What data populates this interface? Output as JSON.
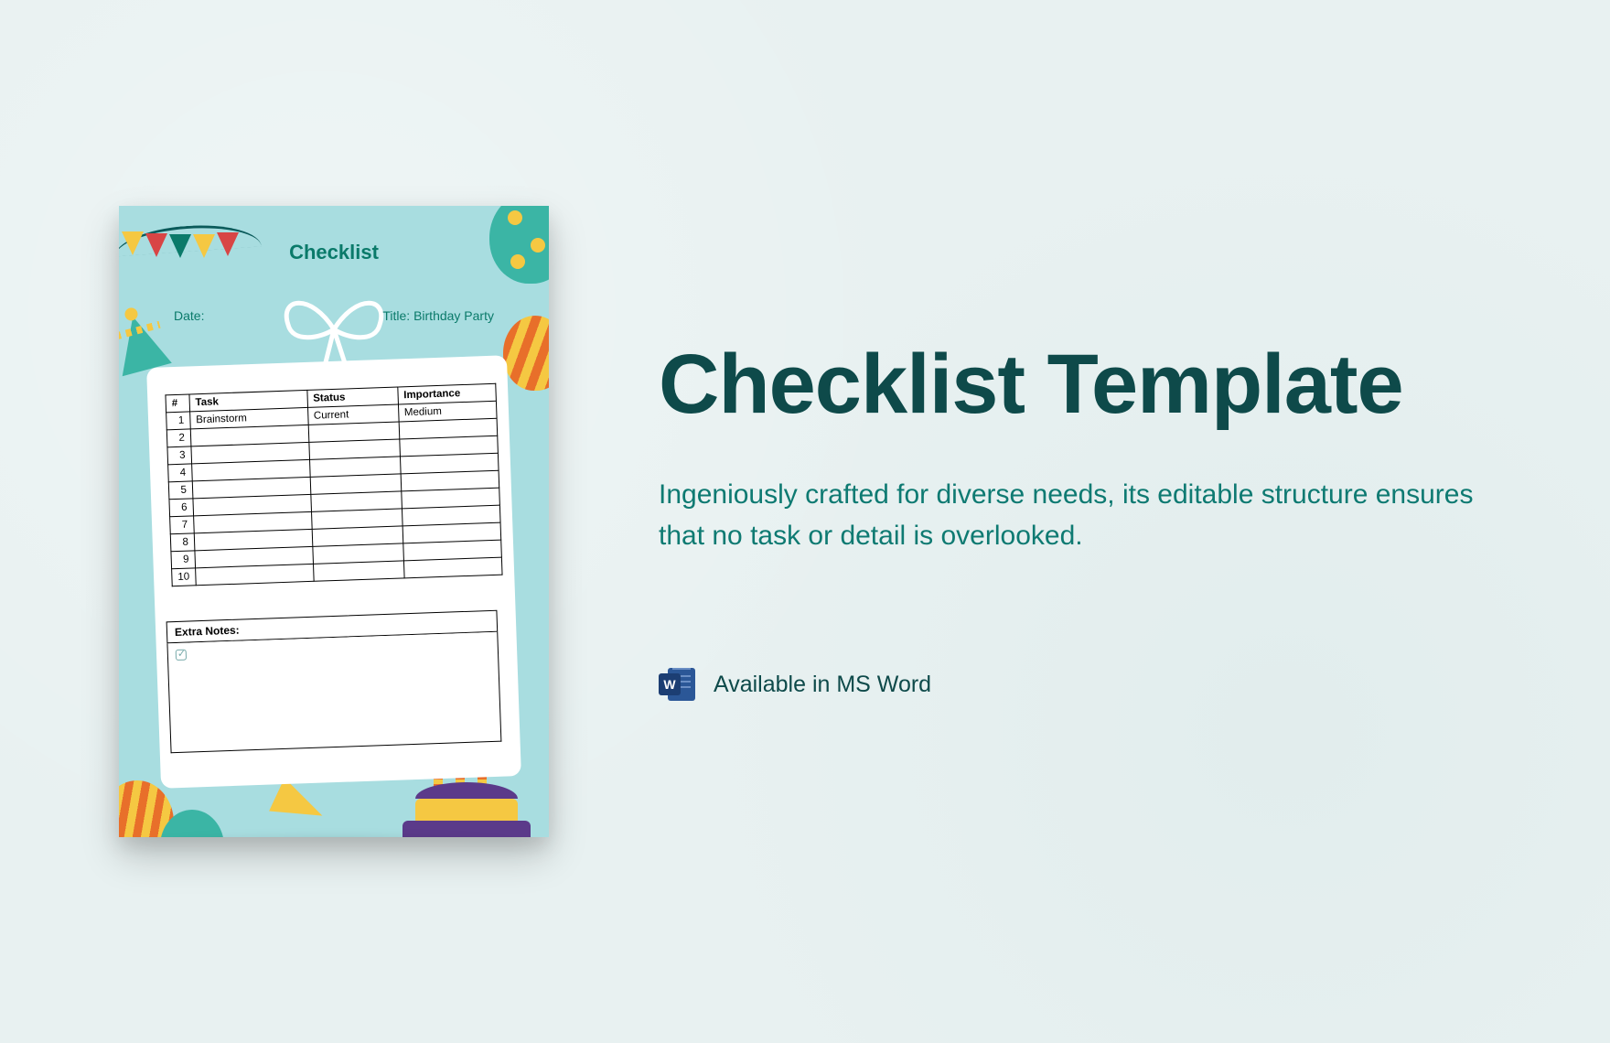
{
  "right": {
    "headline": "Checklist Template",
    "description": "Ingeniously crafted for diverse needs, its editable structure ensures that no task or detail is overlooked.",
    "word_letter": "W",
    "available_text": "Available in MS Word"
  },
  "preview": {
    "heading": "Checklist",
    "date_label": "Date:",
    "title_label": "Title:",
    "title_value": "Birthday Party",
    "table": {
      "headers": {
        "num": "#",
        "task": "Task",
        "status": "Status",
        "importance": "Importance"
      },
      "rows": [
        {
          "num": "1",
          "task": "Brainstorm",
          "status": "Current",
          "importance": "Medium"
        },
        {
          "num": "2",
          "task": "",
          "status": "",
          "importance": ""
        },
        {
          "num": "3",
          "task": "",
          "status": "",
          "importance": ""
        },
        {
          "num": "4",
          "task": "",
          "status": "",
          "importance": ""
        },
        {
          "num": "5",
          "task": "",
          "status": "",
          "importance": ""
        },
        {
          "num": "6",
          "task": "",
          "status": "",
          "importance": ""
        },
        {
          "num": "7",
          "task": "",
          "status": "",
          "importance": ""
        },
        {
          "num": "8",
          "task": "",
          "status": "",
          "importance": ""
        },
        {
          "num": "9",
          "task": "",
          "status": "",
          "importance": ""
        },
        {
          "num": "10",
          "task": "",
          "status": "",
          "importance": ""
        }
      ]
    },
    "notes_label": "Extra Notes:"
  }
}
